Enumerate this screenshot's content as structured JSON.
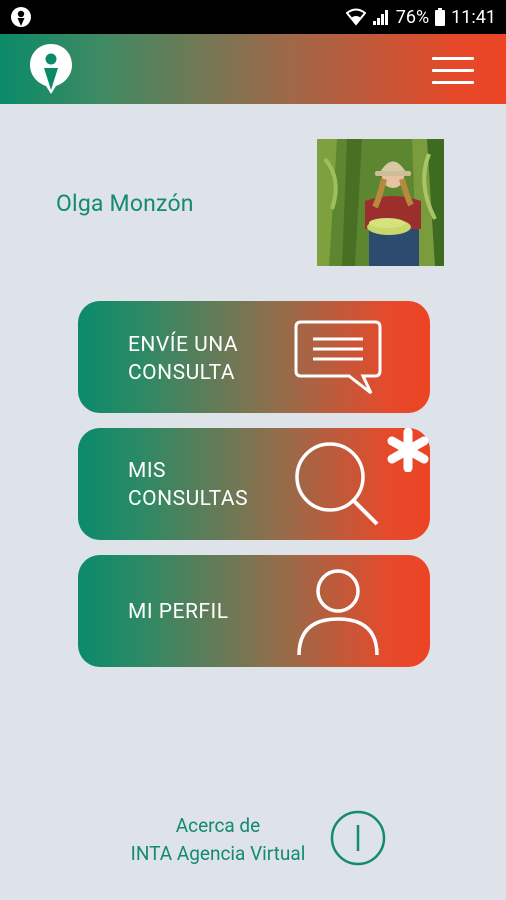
{
  "status_bar": {
    "battery": "76%",
    "time": "11:41"
  },
  "header": {
    "logo_icon": "inta-person-logo-icon",
    "menu_icon": "hamburger-menu-icon"
  },
  "profile": {
    "name": "Olga Monzón",
    "avatar": "farmer-photo"
  },
  "actions": [
    {
      "label": "ENVÍE UNA\nCONSULTA",
      "icon": "chat-bubble-icon"
    },
    {
      "label": "MIS\nCONSULTAS",
      "icon": "search-icon"
    },
    {
      "label": "MI PERFIL",
      "icon": "user-icon"
    }
  ],
  "badge_icon": "asterisk-icon",
  "footer": {
    "about_line1": "Acerca de",
    "about_line2": "INTA Agencia Virtual",
    "info_icon": "info-icon"
  },
  "colors": {
    "green": "#0b8a6a",
    "orange": "#ec4424",
    "background": "#dee3ea",
    "text_green": "#148a72"
  }
}
